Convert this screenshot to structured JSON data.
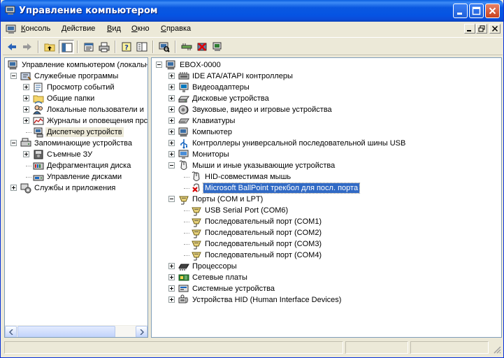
{
  "window": {
    "title": "Управление компьютером"
  },
  "menu": {
    "items": [
      {
        "label": "Консоль",
        "u": "К",
        "rest": "онсоль"
      },
      {
        "label": "Действие",
        "u": "Д",
        "rest": "ействие"
      },
      {
        "label": "Вид",
        "u": "В",
        "rest": "ид"
      },
      {
        "label": "Окно",
        "u": "О",
        "rest": "кно"
      },
      {
        "label": "Справка",
        "u": "С",
        "rest": "правка"
      }
    ]
  },
  "toolbar": {
    "tools": [
      "back-icon",
      "forward-icon",
      "up-folder-icon",
      "show-hide-tree-icon",
      "properties-icon",
      "print-icon",
      "help-icon",
      "console-tree-icon",
      "scan-hardware-icon",
      "update-driver-icon",
      "uninstall-device-icon",
      "disable-device-icon"
    ]
  },
  "left_tree": {
    "items": [
      {
        "label": "Управление компьютером (локальн",
        "level": 0,
        "expander": "none",
        "icon": "computer-management-icon"
      },
      {
        "label": "Служебные программы",
        "level": 1,
        "expander": "minus",
        "icon": "system-tools-icon"
      },
      {
        "label": "Просмотр событий",
        "level": 2,
        "expander": "plus",
        "icon": "event-viewer-icon"
      },
      {
        "label": "Общие папки",
        "level": 2,
        "expander": "plus",
        "icon": "shared-folders-icon"
      },
      {
        "label": "Локальные пользователи и",
        "level": 2,
        "expander": "plus",
        "icon": "local-users-icon"
      },
      {
        "label": "Журналы и оповещения прс",
        "level": 2,
        "expander": "plus",
        "icon": "logs-alerts-icon"
      },
      {
        "label": "Диспетчер устройств",
        "level": 2,
        "expander": "none",
        "icon": "device-manager-icon",
        "selected": true
      },
      {
        "label": "Запоминающие устройства",
        "level": 1,
        "expander": "minus",
        "icon": "storage-icon"
      },
      {
        "label": "Съемные ЗУ",
        "level": 2,
        "expander": "plus",
        "icon": "removable-storage-icon"
      },
      {
        "label": "Дефрагментация диска",
        "level": 2,
        "expander": "none",
        "icon": "defrag-icon"
      },
      {
        "label": "Управление дисками",
        "level": 2,
        "expander": "none",
        "icon": "disk-management-icon"
      },
      {
        "label": "Службы и приложения",
        "level": 1,
        "expander": "plus",
        "icon": "services-apps-icon"
      }
    ]
  },
  "device_tree": {
    "items": [
      {
        "label": "EBOX-0000",
        "level": 0,
        "expander": "minus",
        "icon": "computer-icon"
      },
      {
        "label": "IDE ATA/ATAPI контроллеры",
        "level": 1,
        "expander": "plus",
        "icon": "ide-controller-icon"
      },
      {
        "label": "Видеоадаптеры",
        "level": 1,
        "expander": "plus",
        "icon": "display-adapter-icon"
      },
      {
        "label": "Дисковые устройства",
        "level": 1,
        "expander": "plus",
        "icon": "disk-drive-icon"
      },
      {
        "label": "Звуковые, видео и игровые устройства",
        "level": 1,
        "expander": "plus",
        "icon": "sound-icon"
      },
      {
        "label": "Клавиатуры",
        "level": 1,
        "expander": "plus",
        "icon": "keyboard-icon"
      },
      {
        "label": "Компьютер",
        "level": 1,
        "expander": "plus",
        "icon": "computer-icon"
      },
      {
        "label": "Контроллеры универсальной последовательной шины USB",
        "level": 1,
        "expander": "plus",
        "icon": "usb-icon"
      },
      {
        "label": "Мониторы",
        "level": 1,
        "expander": "plus",
        "icon": "monitor-icon"
      },
      {
        "label": "Мыши и иные указывающие устройства",
        "level": 1,
        "expander": "minus",
        "icon": "mouse-icon"
      },
      {
        "label": "HID-совместимая мышь",
        "level": 2,
        "expander": "none",
        "icon": "mouse-icon"
      },
      {
        "label": "Microsoft BallPoint трекбол для посл. порта",
        "level": 2,
        "expander": "none",
        "icon": "disabled-device-icon",
        "highlighted": true
      },
      {
        "label": "Порты (COM и LPT)",
        "level": 1,
        "expander": "minus",
        "icon": "port-icon"
      },
      {
        "label": "USB Serial Port (COM6)",
        "level": 2,
        "expander": "none",
        "icon": "port-icon"
      },
      {
        "label": "Последовательный порт (COM1)",
        "level": 2,
        "expander": "none",
        "icon": "port-icon"
      },
      {
        "label": "Последовательный порт (COM2)",
        "level": 2,
        "expander": "none",
        "icon": "port-icon"
      },
      {
        "label": "Последовательный порт (COM3)",
        "level": 2,
        "expander": "none",
        "icon": "port-icon"
      },
      {
        "label": "Последовательный порт (COM4)",
        "level": 2,
        "expander": "none",
        "icon": "port-icon"
      },
      {
        "label": "Процессоры",
        "level": 1,
        "expander": "plus",
        "icon": "processor-icon"
      },
      {
        "label": "Сетевые платы",
        "level": 1,
        "expander": "plus",
        "icon": "network-adapter-icon"
      },
      {
        "label": "Системные устройства",
        "level": 1,
        "expander": "plus",
        "icon": "system-devices-icon"
      },
      {
        "label": "Устройства HID (Human Interface Devices)",
        "level": 1,
        "expander": "plus",
        "icon": "hid-icon"
      }
    ]
  },
  "colors": {
    "titlebar": "#0554e3",
    "selection": "#316ac5",
    "face": "#ece9d8",
    "pane_border": "#7f9db9"
  }
}
